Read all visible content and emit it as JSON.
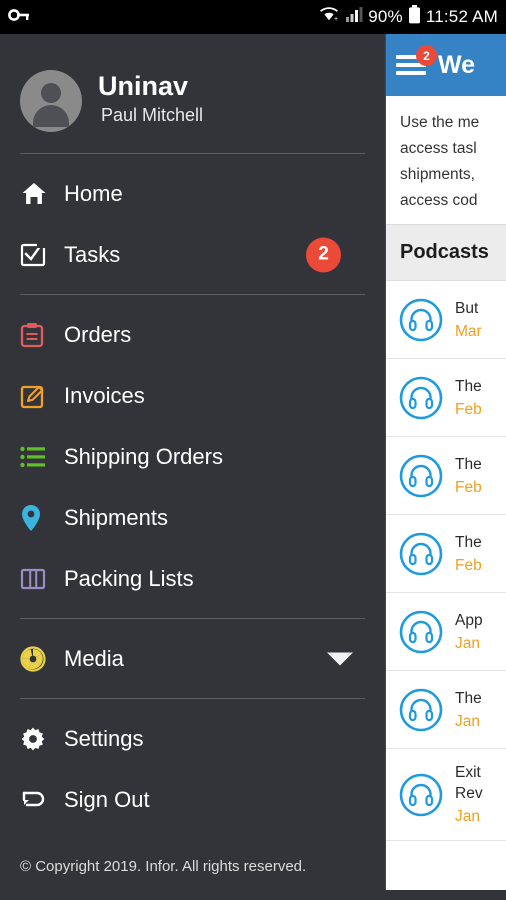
{
  "status_bar": {
    "left_icon": "key-icon",
    "wifi_icon": "wifi-icon",
    "signal_icon": "cell-signal-icon",
    "battery_percent": "90%",
    "battery_icon": "battery-icon",
    "time": "11:52 AM"
  },
  "drawer": {
    "app_name": "Uninav",
    "user_name": "Paul Mitchell",
    "avatar_icon": "person-avatar-icon",
    "items": [
      {
        "label": "Home",
        "icon": "home-icon",
        "color": "#ffffff",
        "badge": null
      },
      {
        "label": "Tasks",
        "icon": "task-check-icon",
        "color": "#ffffff",
        "badge": "2"
      },
      {
        "label": "Orders",
        "icon": "clipboard-icon",
        "color": "#e05b5b",
        "badge": null
      },
      {
        "label": "Invoices",
        "icon": "edit-square-icon",
        "color": "#f0a02a",
        "badge": null
      },
      {
        "label": "Shipping Orders",
        "icon": "list-icon",
        "color": "#5ec226",
        "badge": null
      },
      {
        "label": "Shipments",
        "icon": "map-pin-icon",
        "color": "#3ab4de",
        "badge": null
      },
      {
        "label": "Packing Lists",
        "icon": "columns-icon",
        "color": "#9b8ec4",
        "badge": null
      },
      {
        "label": "Media",
        "icon": "aperture-icon",
        "color": "#e9d14a",
        "badge": null,
        "expandable": true
      },
      {
        "label": "Settings",
        "icon": "gear-icon",
        "color": "#ffffff",
        "badge": null
      },
      {
        "label": "Sign Out",
        "icon": "sign-out-icon",
        "color": "#ffffff",
        "badge": null
      }
    ],
    "copyright": "© Copyright 2019. Infor. All rights reserved."
  },
  "content": {
    "appbar": {
      "menu_icon": "hamburger-menu-icon",
      "menu_badge": "2",
      "title": "We",
      "background": "#3583c4"
    },
    "intro_lines": [
      "Use the me",
      "access tasl",
      "shipments,",
      "access cod"
    ],
    "section_title": "Podcasts",
    "podcasts": [
      {
        "icon": "headphones-icon",
        "title": "But",
        "title2": "",
        "date": "Mar"
      },
      {
        "icon": "headphones-icon",
        "title": "The",
        "title2": "",
        "date": "Feb"
      },
      {
        "icon": "headphones-icon",
        "title": "The",
        "title2": "",
        "date": "Feb"
      },
      {
        "icon": "headphones-icon",
        "title": "The",
        "title2": "",
        "date": "Feb"
      },
      {
        "icon": "headphones-icon",
        "title": "App",
        "title2": "",
        "date": "Jan"
      },
      {
        "icon": "headphones-icon",
        "title": "The",
        "title2": "",
        "date": "Jan"
      },
      {
        "icon": "headphones-icon",
        "title": "Exit",
        "title2": "Rev",
        "date": "Jan"
      }
    ],
    "colors": {
      "accent": "#3583c4",
      "date": "#f0a020",
      "badge": "#eb4a38"
    }
  }
}
